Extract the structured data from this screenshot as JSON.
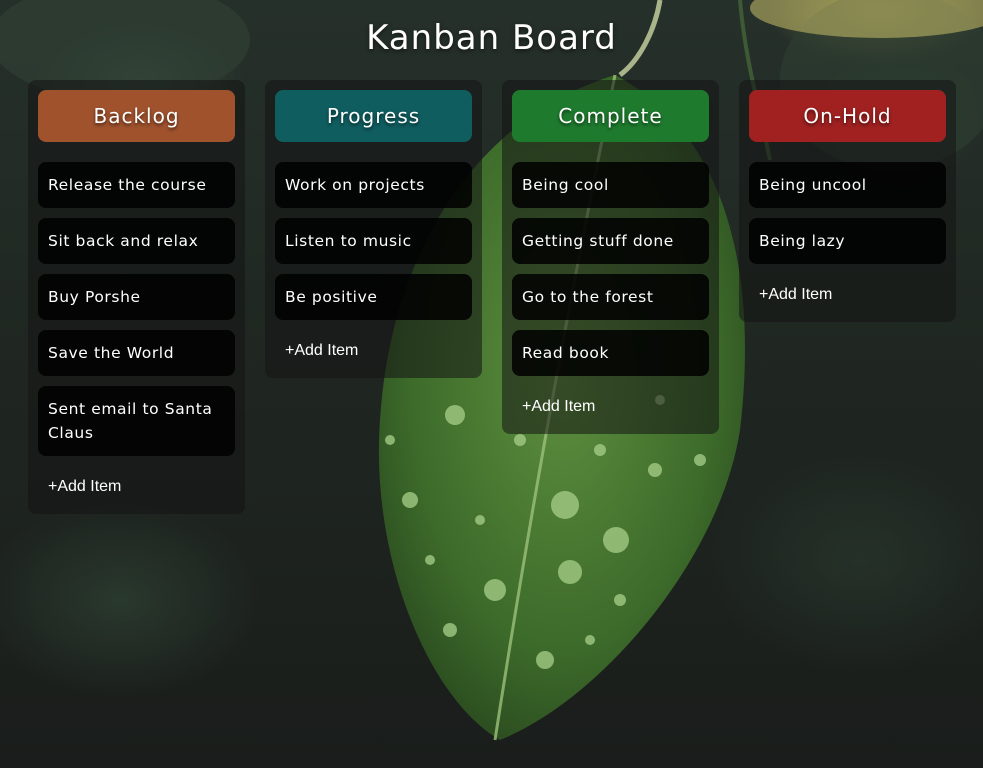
{
  "app": {
    "title": "Kanban Board"
  },
  "colors": {
    "backlog": "#a0522d",
    "progress": "#0f5d5f",
    "complete": "#1e7b2e",
    "onhold": "#a12121"
  },
  "columns": [
    {
      "name": "Backlog",
      "items": [
        "Release the course",
        "Sit back and relax",
        "Buy Porshe",
        "Save the World",
        "Sent email to Santa Claus"
      ],
      "add_label": "+Add Item"
    },
    {
      "name": "Progress",
      "items": [
        "Work on projects",
        "Listen to music",
        "Be positive"
      ],
      "add_label": "+Add Item"
    },
    {
      "name": "Complete",
      "items": [
        "Being cool",
        "Getting stuff done",
        "Go to the forest",
        "Read book"
      ],
      "add_label": "+Add Item"
    },
    {
      "name": "On-Hold",
      "items": [
        "Being uncool",
        "Being lazy"
      ],
      "add_label": "+Add Item"
    }
  ]
}
